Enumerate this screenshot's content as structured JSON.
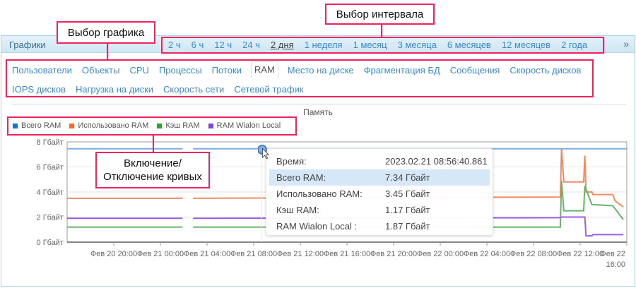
{
  "header": {
    "title": "Графики",
    "collapse_icon": "double-chevron-up-icon"
  },
  "intervals": [
    {
      "label": "2 ч"
    },
    {
      "label": "6 ч"
    },
    {
      "label": "12 ч"
    },
    {
      "label": "24 ч"
    },
    {
      "label": "2 дня",
      "active": true
    },
    {
      "label": "1 неделя"
    },
    {
      "label": "1 месяц"
    },
    {
      "label": "3 месяца"
    },
    {
      "label": "6 месяцев"
    },
    {
      "label": "12 месяцев"
    },
    {
      "label": "2 года"
    }
  ],
  "tabs": [
    {
      "label": "Пользователи"
    },
    {
      "label": "Объекты"
    },
    {
      "label": "CPU"
    },
    {
      "label": "Процессы"
    },
    {
      "label": "Потоки"
    },
    {
      "label": "RAM",
      "active": true
    },
    {
      "label": "Место на диске"
    },
    {
      "label": "Фрагментация БД"
    },
    {
      "label": "Сообщения"
    },
    {
      "label": "Скорость дисков"
    },
    {
      "label": "IOPS дисков"
    },
    {
      "label": "Нагрузка на диски"
    },
    {
      "label": "Скорость сети"
    },
    {
      "label": "Сетевой трафик"
    }
  ],
  "annotations": {
    "interval": "Выбор интервала",
    "chart": "Выбор графика",
    "toggle_line1": "Включение/",
    "toggle_line2": "Отключение кривых"
  },
  "tooltip": {
    "rows": [
      {
        "k": "Время:",
        "v": "2023.02.21 08:56:40.861"
      },
      {
        "k": "Всего RAM:",
        "v": "7.34 Гбайт",
        "hl": true
      },
      {
        "k": "Использовано RAM:",
        "v": "3.45 Гбайт"
      },
      {
        "k": "Кэш RAM:",
        "v": "1.17 Гбайт"
      },
      {
        "k": "RAM Wialon Local :",
        "v": "1.87 Гбайт"
      }
    ]
  },
  "chart_data": {
    "type": "line",
    "title": "Память",
    "ylim": [
      0,
      8
    ],
    "xlim_hours": [
      0,
      48
    ],
    "yticks": [
      "0 Гбайт",
      "2 Гбайт",
      "4 Гбайт",
      "6 Гбайт",
      "8 Гбайт"
    ],
    "xticks": [
      {
        "h": 4,
        "label": "Фев 20 20:00"
      },
      {
        "h": 8,
        "label": "Фев 21 00:00"
      },
      {
        "h": 12,
        "label": "Фев 21 04:00"
      },
      {
        "h": 16,
        "label": "Фев 21 08:00"
      },
      {
        "h": 20,
        "label": "Фев 21 12:00"
      },
      {
        "h": 24,
        "label": "Фев 21 16:00"
      },
      {
        "h": 28,
        "label": "Фев 21 20:00"
      },
      {
        "h": 32,
        "label": "Фев 22 00:00"
      },
      {
        "h": 36,
        "label": "Фев 22 04:00"
      },
      {
        "h": 40,
        "label": "Фев 22 08:00"
      },
      {
        "h": 44,
        "label": "Фев 22 12:00"
      },
      {
        "h": 48,
        "label": "Фев 22 16:00"
      }
    ],
    "series": [
      {
        "name": "Всего RAM",
        "color": "#1f6fd0",
        "line": "#7aaee0",
        "points": [
          [
            0,
            7.45
          ],
          [
            9.9,
            7.45
          ],
          null,
          [
            10.8,
            7.45
          ],
          [
            48,
            7.45
          ]
        ]
      },
      {
        "name": "Использовано RAM",
        "color": "#f26a3a",
        "line": "#f28a62",
        "points": [
          [
            0,
            3.5
          ],
          [
            9.9,
            3.5
          ],
          null,
          [
            10.8,
            3.5
          ],
          [
            26,
            3.55
          ],
          [
            42.3,
            3.6
          ],
          [
            42.4,
            7.5
          ],
          [
            42.6,
            4.8
          ],
          [
            44.3,
            4.8
          ],
          [
            44.4,
            6.9
          ],
          [
            44.5,
            4.0
          ],
          [
            45,
            4.0
          ],
          [
            45.1,
            3.8
          ],
          [
            46.8,
            3.8
          ],
          [
            47,
            3.3
          ],
          [
            47.7,
            2.8
          ]
        ]
      },
      {
        "name": "Кэш RAM",
        "color": "#3a9a3a",
        "line": "#6bb56b",
        "points": [
          [
            0,
            1.2
          ],
          [
            9.9,
            1.2
          ],
          null,
          [
            10.8,
            1.2
          ],
          [
            42.3,
            1.2
          ],
          [
            42.4,
            4.9
          ],
          [
            42.6,
            2.5
          ],
          [
            44.3,
            2.5
          ],
          [
            44.4,
            4.5
          ],
          [
            45,
            3.0
          ],
          [
            46.8,
            2.9
          ],
          [
            47.7,
            1.8
          ]
        ]
      },
      {
        "name": "RAM Wialon Local",
        "color": "#8a3ee0",
        "line": "#9a5ee6",
        "points": [
          [
            0,
            1.9
          ],
          [
            9.9,
            1.9
          ],
          null,
          [
            10.8,
            1.9
          ],
          [
            42.3,
            1.95
          ],
          [
            42.4,
            2.0
          ],
          [
            44.4,
            2.0
          ],
          [
            44.5,
            0.5
          ],
          [
            45,
            0.5
          ],
          [
            45.1,
            0.6
          ],
          [
            47.7,
            0.6
          ]
        ]
      }
    ]
  }
}
